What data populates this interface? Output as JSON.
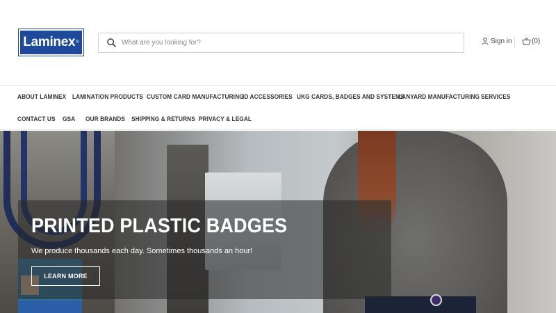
{
  "header": {
    "logo_text": "Laminex",
    "logo_mark": "®",
    "search_placeholder": "What are you looking for?",
    "sign_in": "Sign in",
    "cart_count": "(0)"
  },
  "nav": {
    "items": [
      "ABOUT LAMINEX",
      "LAMINATION PRODUCTS",
      "CUSTOM CARD MANUFACTURING",
      "ID ACCESSORIES",
      "UKG CARDS, BADGES AND SYSTEMS",
      "LANYARD MANUFACTURING",
      "SERVICES",
      "CONTACT US",
      "GSA",
      "OUR BRANDS",
      "SHIPPING & RETURNS",
      "PRIVACY & LEGAL"
    ]
  },
  "hero": {
    "title": "PRINTED PLASTIC BADGES",
    "subtitle": "We produce thousands each day. Sometimes thousands an hour!",
    "button": "LEARN MORE"
  },
  "colors": {
    "brand": "#1f4a9b",
    "text": "#333333"
  },
  "icons": [
    "search-icon",
    "user-icon",
    "cart-icon"
  ]
}
